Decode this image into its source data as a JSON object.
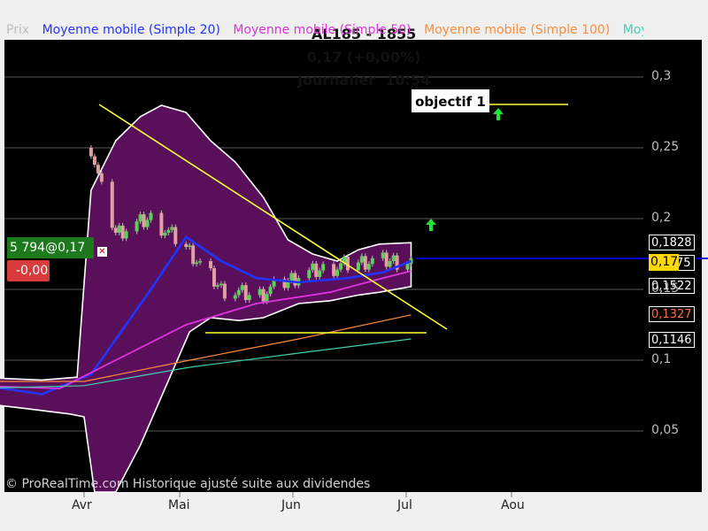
{
  "header": {
    "symbol": "AL185 - 1855",
    "quote": "0,17 (+0,00%)",
    "period": "Journalier  10:54"
  },
  "legend": [
    {
      "label": "Prix",
      "color": "#bdbdbd"
    },
    {
      "label": "Moyenne mobile (Simple 20)",
      "color": "#2233ff"
    },
    {
      "label": "Moyenne mobile (Simple 50)",
      "color": "#dd33dd"
    },
    {
      "label": "Moyenne mobile (Simple 100)",
      "color": "#ff8c3a"
    },
    {
      "label": "Moye",
      "color": "#40d0b0"
    }
  ],
  "copyright": "© ProRealTime.com Historique ajusté suite aux dividendes",
  "position": {
    "size_label": "5 794@0,17",
    "pnl": "-0,00"
  },
  "annotation": {
    "objectif": "objectif 1"
  },
  "price_labels": {
    "upper_band": "0,1828",
    "current": "0,17",
    "hidden_value": "75",
    "lower_band": "0,1522",
    "ma100": "0,1327",
    "ma200": "0,1146"
  },
  "colors": {
    "background": "#000000",
    "band_fill": "#5a0f5a",
    "candle_up": "#5ad25a",
    "candle_down": "#e0a0a0",
    "trendline": "#ffff33",
    "current_price_line": "#0000cc",
    "arrow": "#22e33c"
  },
  "chart_data": {
    "type": "line",
    "title": "AL185 - 1855",
    "x": [
      "Avr",
      "Mai",
      "Jun",
      "Jul",
      "Aou"
    ],
    "ylim": [
      0.005,
      0.335
    ],
    "yticks": [
      0.05,
      0.1,
      0.15,
      0.2,
      0.25,
      0.3
    ],
    "ytick_labels": [
      "0,05",
      "0,1",
      "0,15",
      "0,2",
      "0,25",
      "0,3"
    ],
    "grid": true,
    "current_price": 0.17,
    "series": [
      {
        "name": "Prix",
        "points": [
          [
            "2012-03-01",
            0.085
          ],
          [
            "2012-03-15",
            0.082
          ],
          [
            "2012-03-25",
            0.078
          ],
          [
            "2012-04-01",
            0.083
          ],
          [
            "2012-04-03",
            0.25
          ],
          [
            "2012-04-06",
            0.22
          ],
          [
            "2012-04-10",
            0.19
          ],
          [
            "2012-04-20",
            0.2
          ],
          [
            "2012-04-30",
            0.18
          ],
          [
            "2012-05-10",
            0.15
          ],
          [
            "2012-05-20",
            0.145
          ],
          [
            "2012-06-01",
            0.16
          ],
          [
            "2012-06-10",
            0.165
          ],
          [
            "2012-06-20",
            0.17
          ],
          [
            "2012-06-30",
            0.17
          ],
          [
            "2012-07-03",
            0.17
          ]
        ]
      },
      {
        "name": "Moyenne mobile (Simple 20)",
        "points": [
          [
            "2012-03-01",
            0.083
          ],
          [
            "2012-03-20",
            0.076
          ],
          [
            "2012-04-03",
            0.09
          ],
          [
            "2012-04-20",
            0.15
          ],
          [
            "2012-04-30",
            0.187
          ],
          [
            "2012-05-10",
            0.17
          ],
          [
            "2012-05-20",
            0.158
          ],
          [
            "2012-06-01",
            0.155
          ],
          [
            "2012-06-15",
            0.158
          ],
          [
            "2012-06-25",
            0.162
          ],
          [
            "2012-07-03",
            0.17
          ]
        ]
      },
      {
        "name": "Moyenne mobile (Simple 50)",
        "points": [
          [
            "2012-03-01",
            0.082
          ],
          [
            "2012-03-25",
            0.08
          ],
          [
            "2012-04-10",
            0.1
          ],
          [
            "2012-04-30",
            0.125
          ],
          [
            "2012-05-20",
            0.14
          ],
          [
            "2012-06-10",
            0.148
          ],
          [
            "2012-06-25",
            0.158
          ],
          [
            "2012-07-03",
            0.163
          ]
        ]
      },
      {
        "name": "Moyenne mobile (Simple 100)",
        "points": [
          [
            "2012-03-01",
            0.085
          ],
          [
            "2012-04-01",
            0.085
          ],
          [
            "2012-05-01",
            0.1
          ],
          [
            "2012-06-01",
            0.115
          ],
          [
            "2012-07-03",
            0.132
          ]
        ]
      },
      {
        "name": "Moye",
        "points": [
          [
            "2012-03-01",
            0.08
          ],
          [
            "2012-04-01",
            0.082
          ],
          [
            "2012-05-01",
            0.095
          ],
          [
            "2012-06-01",
            0.105
          ],
          [
            "2012-07-03",
            0.115
          ]
        ]
      }
    ]
  }
}
